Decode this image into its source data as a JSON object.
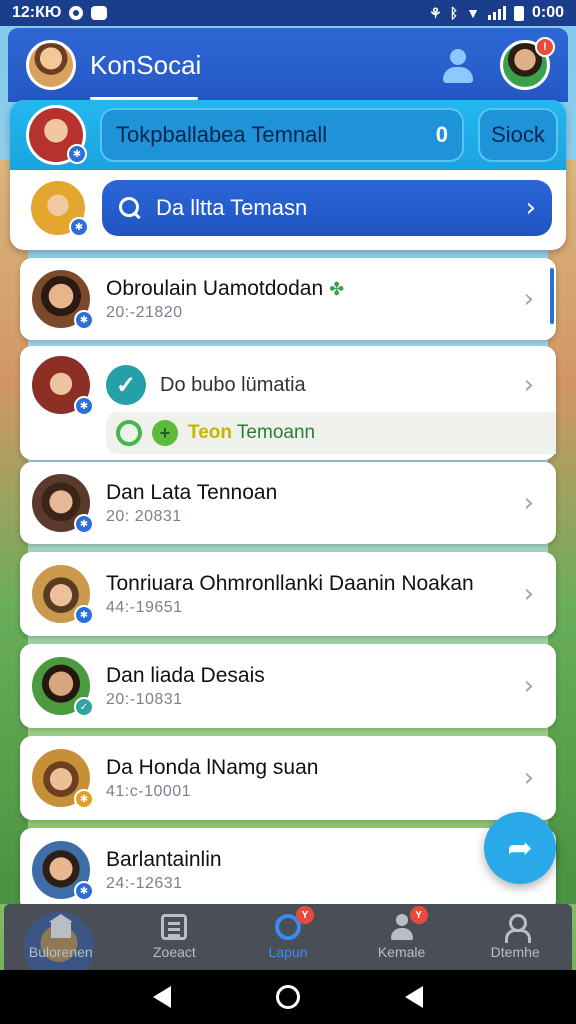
{
  "status_bar": {
    "time_left": "12:КЮ",
    "time_right": "0:00"
  },
  "header": {
    "title": "KonSocai",
    "notification_count": "!"
  },
  "group": {
    "name": "Tokpballabea Temnall",
    "count": "0",
    "stock_label": "Siock"
  },
  "search": {
    "placeholder": "Da lltta Temasn"
  },
  "contacts": [
    {
      "name": "Obroulain Uamotdodan",
      "sub": "20:-21820"
    },
    {
      "check_label": "Do bubo lümatia",
      "tag_label": "Teon",
      "tag_text": "Temoann"
    },
    {
      "name": "Dan Lata Tennoan",
      "sub": "20: 20831"
    },
    {
      "name": "Tonriuara Ohmronllanki Daanin Noakan",
      "sub": "44:-19651"
    },
    {
      "name": "Dan liada Desais",
      "sub": "20:-10831"
    },
    {
      "name": "Da Honda lNamg suan",
      "sub": "41:c-10001"
    },
    {
      "name": "Barlantainlin",
      "sub": "24:-12631"
    }
  ],
  "nav": [
    {
      "label": "Bulorenen",
      "icon": "building-icon"
    },
    {
      "label": "Zoeact",
      "icon": "document-icon"
    },
    {
      "label": "Lapun",
      "icon": "ring-icon",
      "badge": "Y"
    },
    {
      "label": "Kemale",
      "icon": "person-icon",
      "badge": "Y"
    },
    {
      "label": "Dtemhe",
      "icon": "person-outline-icon"
    }
  ],
  "colors": {
    "primary": "#2458c4",
    "accent": "#29a9ea",
    "nav_active": "#3a8df0"
  }
}
